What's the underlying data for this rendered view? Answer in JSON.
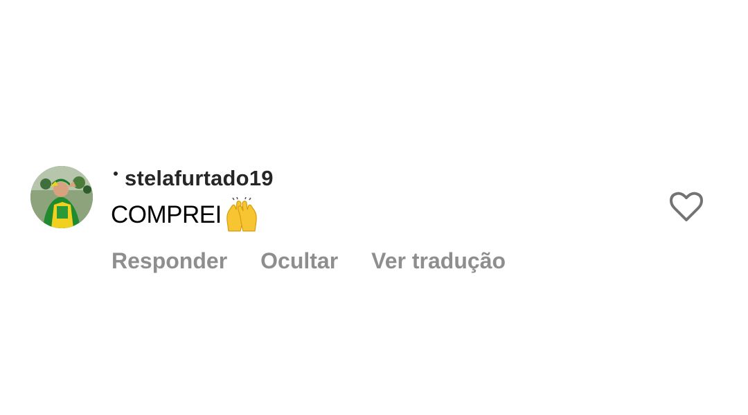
{
  "comment": {
    "username": "stelafurtado19",
    "text": "COMPREI",
    "emoji_icon": "raising-hands-icon",
    "like_icon": "heart-outline-icon"
  },
  "actions": {
    "reply_label": "Responder",
    "hide_label": "Ocultar",
    "translate_label": "Ver tradução"
  },
  "colors": {
    "username": "#262626",
    "comment_text": "#000000",
    "action_text": "#8e8e8e",
    "heart_outline": "#737373",
    "emoji_yellow": "#f7c531"
  }
}
